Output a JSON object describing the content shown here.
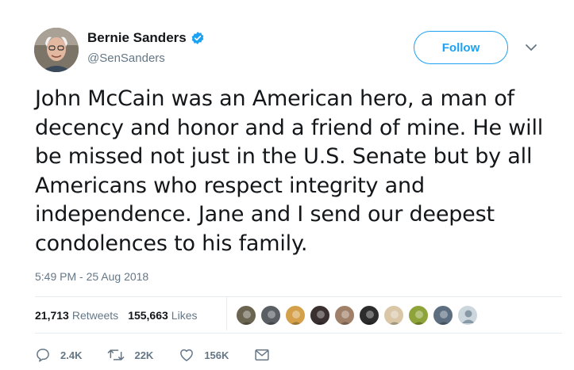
{
  "user": {
    "display_name": "Bernie Sanders",
    "handle": "@SenSanders",
    "verified": true
  },
  "follow_button": {
    "label": "Follow"
  },
  "tweet": {
    "text": "John McCain was an American hero, a man of decency and honor and a friend of mine. He will be missed not just in the U.S. Senate but by all Americans who respect integrity and independence. Jane and I send our deepest condolences to his family.",
    "timestamp": "5:49 PM - 25 Aug 2018"
  },
  "stats": {
    "retweets_count": "21,713",
    "retweets_label": "Retweets",
    "likes_count": "155,663",
    "likes_label": "Likes"
  },
  "likers": [
    {
      "icon": "liker-avatar",
      "color": "#6b6450"
    },
    {
      "icon": "liker-avatar",
      "color": "#5a5f63"
    },
    {
      "icon": "liker-avatar",
      "color": "#d4a04a"
    },
    {
      "icon": "liker-avatar",
      "color": "#3a3030"
    },
    {
      "icon": "liker-avatar",
      "color": "#a08068"
    },
    {
      "icon": "liker-avatar",
      "color": "#2c2c2c"
    },
    {
      "icon": "liker-avatar",
      "color": "#d9c7a8"
    },
    {
      "icon": "liker-avatar",
      "color": "#8ea33a"
    },
    {
      "icon": "liker-avatar",
      "color": "#5c6e80"
    },
    {
      "icon": "default-avatar",
      "color": "#ccd6dd"
    }
  ],
  "actions": {
    "reply_count": "2.4K",
    "retweet_count": "22K",
    "like_count": "156K"
  },
  "colors": {
    "accent": "#1da1f2",
    "muted": "#657786",
    "text": "#14171a",
    "divider": "#e6ecf0"
  }
}
